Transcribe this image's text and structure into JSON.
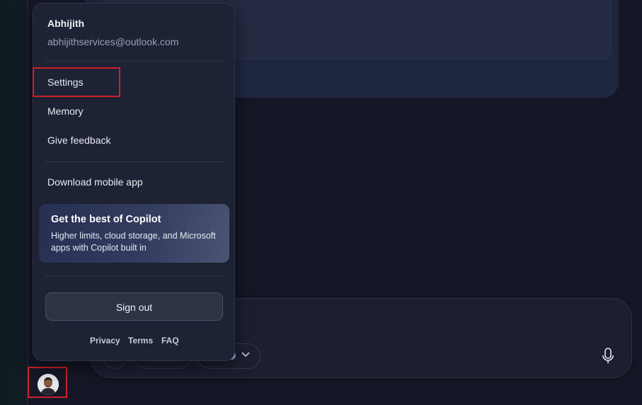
{
  "user": {
    "name": "Abhijith",
    "email": "abhijithservices@outlook.com"
  },
  "menu": {
    "items": [
      {
        "label": "Settings"
      },
      {
        "label": "Memory"
      },
      {
        "label": "Give feedback"
      }
    ],
    "download_label": "Download mobile app",
    "promo": {
      "title": "Get the best of Copilot",
      "body": "Higher limits, cloud storage, and Microsoft apps with Copilot built in"
    },
    "signout_label": "Sign out",
    "footer": {
      "privacy": "Privacy",
      "terms": "Terms",
      "faq": "FAQ"
    }
  },
  "icons": {
    "mic": "microphone-icon",
    "chevron": "chevron-down-icon",
    "avatar": "user-avatar"
  },
  "colors": {
    "highlight": "#d02028",
    "menu_bg": "#1d2234",
    "page_bg": "#151726"
  }
}
